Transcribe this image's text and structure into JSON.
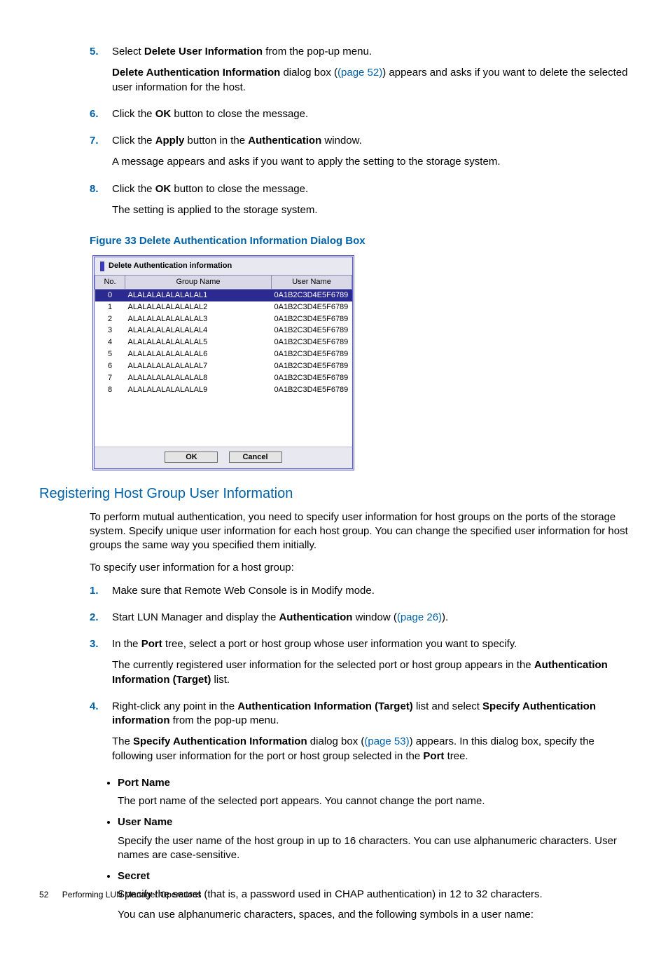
{
  "steps_a": [
    {
      "num": "5.",
      "paras": [
        {
          "frags": [
            {
              "t": "Select "
            },
            {
              "t": "Delete User Information",
              "b": true
            },
            {
              "t": " from the pop-up menu."
            }
          ]
        },
        {
          "frags": [
            {
              "t": "Delete Authentication Information",
              "b": true
            },
            {
              "t": " dialog box ("
            },
            {
              "t": "(page 52)",
              "link": true
            },
            {
              "t": ") appears and asks if you want to delete the selected user information for the host."
            }
          ]
        }
      ]
    },
    {
      "num": "6.",
      "paras": [
        {
          "frags": [
            {
              "t": "Click the "
            },
            {
              "t": "OK",
              "b": true
            },
            {
              "t": " button to close the message."
            }
          ]
        }
      ]
    },
    {
      "num": "7.",
      "paras": [
        {
          "frags": [
            {
              "t": "Click the "
            },
            {
              "t": "Apply",
              "b": true
            },
            {
              "t": " button in the "
            },
            {
              "t": "Authentication",
              "b": true
            },
            {
              "t": " window."
            }
          ]
        },
        {
          "frags": [
            {
              "t": "A message appears and asks if you want to apply the setting to the storage system."
            }
          ]
        }
      ]
    },
    {
      "num": "8.",
      "paras": [
        {
          "frags": [
            {
              "t": "Click the "
            },
            {
              "t": "OK",
              "b": true
            },
            {
              "t": " button to close the message."
            }
          ]
        },
        {
          "frags": [
            {
              "t": "The setting is applied to the storage system."
            }
          ]
        }
      ]
    }
  ],
  "figure_caption": "Figure 33 Delete Authentication Information Dialog Box",
  "dialog": {
    "title": "Delete Authentication information",
    "headers": {
      "no": "No.",
      "gn": "Group Name",
      "un": "User Name"
    },
    "rows": [
      {
        "no": "0",
        "gn": "ALALALALALALALAL1",
        "un": "0A1B2C3D4E5F6789",
        "sel": true
      },
      {
        "no": "1",
        "gn": "ALALALALALALALAL2",
        "un": "0A1B2C3D4E5F6789"
      },
      {
        "no": "2",
        "gn": "ALALALALALALALAL3",
        "un": "0A1B2C3D4E5F6789"
      },
      {
        "no": "3",
        "gn": "ALALALALALALALAL4",
        "un": "0A1B2C3D4E5F6789"
      },
      {
        "no": "4",
        "gn": "ALALALALALALALAL5",
        "un": "0A1B2C3D4E5F6789"
      },
      {
        "no": "5",
        "gn": "ALALALALALALALAL6",
        "un": "0A1B2C3D4E5F6789"
      },
      {
        "no": "6",
        "gn": "ALALALALALALALAL7",
        "un": "0A1B2C3D4E5F6789"
      },
      {
        "no": "7",
        "gn": "ALALALALALALALAL8",
        "un": "0A1B2C3D4E5F6789"
      },
      {
        "no": "8",
        "gn": "ALALALALALALALAL9",
        "un": "0A1B2C3D4E5F6789"
      }
    ],
    "ok": "OK",
    "cancel": "Cancel"
  },
  "section_heading": "Registering Host Group User Information",
  "intro_paras": [
    "To perform mutual authentication, you need to specify user information for host groups on the ports of the storage system. Specify unique user information for each host group. You can change the specified user information for host groups the same way you specified them initially.",
    "To specify user information for a host group:"
  ],
  "steps_b": [
    {
      "num": "1.",
      "paras": [
        {
          "frags": [
            {
              "t": "Make sure that Remote Web Console is in Modify mode."
            }
          ]
        }
      ]
    },
    {
      "num": "2.",
      "paras": [
        {
          "frags": [
            {
              "t": "Start LUN Manager and display the "
            },
            {
              "t": "Authentication",
              "b": true
            },
            {
              "t": " window ("
            },
            {
              "t": "(page 26)",
              "link": true
            },
            {
              "t": ")."
            }
          ]
        }
      ]
    },
    {
      "num": "3.",
      "paras": [
        {
          "frags": [
            {
              "t": "In the "
            },
            {
              "t": "Port",
              "b": true
            },
            {
              "t": " tree, select a port or host group whose user information you want to specify."
            }
          ]
        },
        {
          "frags": [
            {
              "t": "The currently registered user information for the selected port or host group appears in the "
            },
            {
              "t": "Authentication Information (Target)",
              "b": true
            },
            {
              "t": " list."
            }
          ]
        }
      ]
    },
    {
      "num": "4.",
      "paras": [
        {
          "frags": [
            {
              "t": "Right-click any point in the "
            },
            {
              "t": "Authentication Information (Target)",
              "b": true
            },
            {
              "t": " list and select "
            },
            {
              "t": "Specify Authentication information",
              "b": true
            },
            {
              "t": " from the pop-up menu."
            }
          ]
        },
        {
          "frags": [
            {
              "t": "The "
            },
            {
              "t": "Specify Authentication Information",
              "b": true
            },
            {
              "t": " dialog box ("
            },
            {
              "t": "(page 53)",
              "link": true
            },
            {
              "t": ") appears. In this dialog box, specify the following user information for the port or host group selected in the "
            },
            {
              "t": "Port",
              "b": true
            },
            {
              "t": " tree."
            }
          ]
        }
      ]
    }
  ],
  "bullets": [
    {
      "title": "Port Name",
      "paras": [
        "The port name of the selected port appears. You cannot change the port name."
      ]
    },
    {
      "title": "User Name",
      "paras": [
        "Specify the user name of the host group in up to 16 characters. You can use alphanumeric characters. User names are case-sensitive."
      ]
    },
    {
      "title": "Secret",
      "paras": [
        "Specify the secret (that is, a password used in CHAP authentication) in 12 to 32 characters.",
        "You can use alphanumeric characters, spaces, and the following symbols in a user name:"
      ]
    }
  ],
  "footer": {
    "page": "52",
    "title": "Performing LUN Manager Operations"
  }
}
